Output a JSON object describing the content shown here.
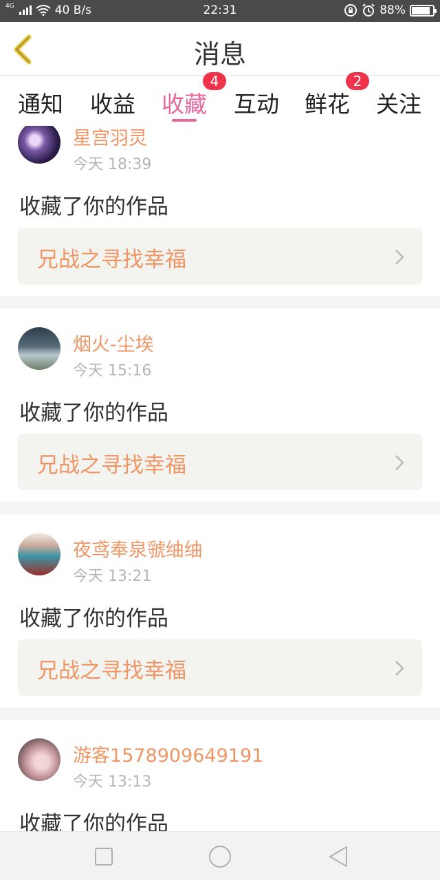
{
  "status_bar": {
    "network_type": "4G",
    "speed": "40 B/s",
    "time": "22:31",
    "battery": "88%",
    "battery_level": 0.88,
    "icons": [
      "signal-icon",
      "wifi-icon",
      "rotation-lock-icon",
      "alarm-icon",
      "battery-icon"
    ]
  },
  "header": {
    "title": "消息",
    "back_icon": "chevron-left-icon"
  },
  "tabs": [
    {
      "label": "通知",
      "badge": null,
      "active": false
    },
    {
      "label": "收益",
      "badge": null,
      "active": false
    },
    {
      "label": "收藏",
      "badge": "4",
      "active": true
    },
    {
      "label": "互动",
      "badge": null,
      "active": false
    },
    {
      "label": "鲜花",
      "badge": "2",
      "active": false
    },
    {
      "label": "关注",
      "badge": null,
      "active": false
    }
  ],
  "feed": [
    {
      "username": "星宫羽灵",
      "time": "今天 18:39",
      "action": "收藏了你的作品",
      "work_title": "兄战之寻找幸福"
    },
    {
      "username": "烟火-尘埃",
      "time": "今天 15:16",
      "action": "收藏了你的作品",
      "work_title": "兄战之寻找幸福"
    },
    {
      "username": "夜鸢奉泉虢䌷䌷",
      "time": "今天 13:21",
      "action": "收藏了你的作品",
      "work_title": "兄战之寻找幸福"
    },
    {
      "username": "游客1578909649191",
      "time": "今天 13:13",
      "action": "收藏了你的作品",
      "work_title": ""
    }
  ],
  "colors": {
    "accent_pink": "#e6689a",
    "name_orange": "#ee9665",
    "badge_red": "#f0334a",
    "status_bar_bg": "#4a4a4a"
  },
  "navbar": {
    "icons": [
      "recent-apps-icon",
      "home-icon",
      "back-icon"
    ]
  }
}
